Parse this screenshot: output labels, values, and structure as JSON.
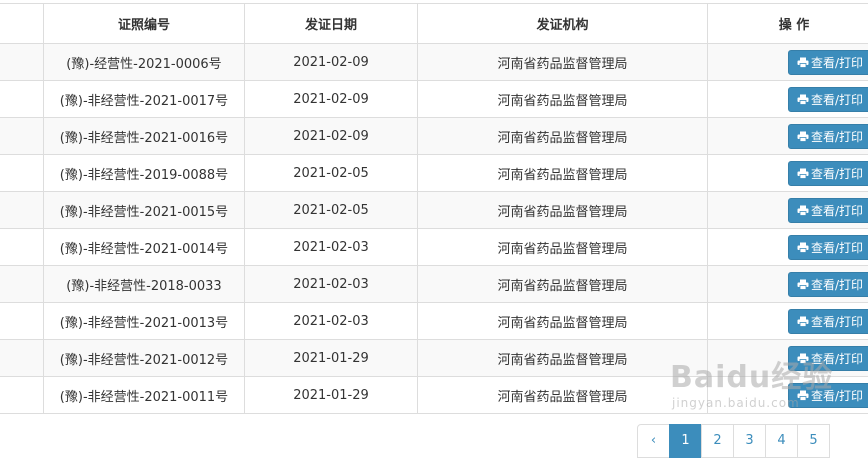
{
  "table": {
    "headers": [
      "",
      "证照编号",
      "发证日期",
      "发证机构",
      "操 作"
    ],
    "rows": [
      {
        "cert_no": "(豫)-经营性-2021-0006号",
        "date": "2021-02-09",
        "authority": "河南省药品监督管理局",
        "action": "查看/打印"
      },
      {
        "cert_no": "(豫)-非经营性-2021-0017号",
        "date": "2021-02-09",
        "authority": "河南省药品监督管理局",
        "action": "查看/打印"
      },
      {
        "cert_no": "(豫)-非经营性-2021-0016号",
        "date": "2021-02-09",
        "authority": "河南省药品监督管理局",
        "action": "查看/打印"
      },
      {
        "cert_no": "(豫)-非经营性-2019-0088号",
        "date": "2021-02-05",
        "authority": "河南省药品监督管理局",
        "action": "查看/打印"
      },
      {
        "cert_no": "(豫)-非经营性-2021-0015号",
        "date": "2021-02-05",
        "authority": "河南省药品监督管理局",
        "action": "查看/打印"
      },
      {
        "cert_no": "(豫)-非经营性-2021-0014号",
        "date": "2021-02-03",
        "authority": "河南省药品监督管理局",
        "action": "查看/打印"
      },
      {
        "cert_no": "(豫)-非经营性-2018-0033",
        "date": "2021-02-03",
        "authority": "河南省药品监督管理局",
        "action": "查看/打印"
      },
      {
        "cert_no": "(豫)-非经营性-2021-0013号",
        "date": "2021-02-03",
        "authority": "河南省药品监督管理局",
        "action": "查看/打印"
      },
      {
        "cert_no": "(豫)-非经营性-2021-0012号",
        "date": "2021-01-29",
        "authority": "河南省药品监督管理局",
        "action": "查看/打印"
      },
      {
        "cert_no": "(豫)-非经营性-2021-0011号",
        "date": "2021-01-29",
        "authority": "河南省药品监督管理局",
        "action": "查看/打印"
      }
    ]
  },
  "pagination": {
    "prev": "‹",
    "pages": [
      "1",
      "2",
      "3",
      "4",
      "5"
    ],
    "active_index": 0
  },
  "action_icon": "print-icon",
  "colors": {
    "button": "#3c8dbc",
    "row_stripe": "#f9f9f9",
    "border": "#dddddd"
  },
  "watermark": {
    "main": "Baidu经验",
    "sub": "jingyan.baidu.com"
  }
}
